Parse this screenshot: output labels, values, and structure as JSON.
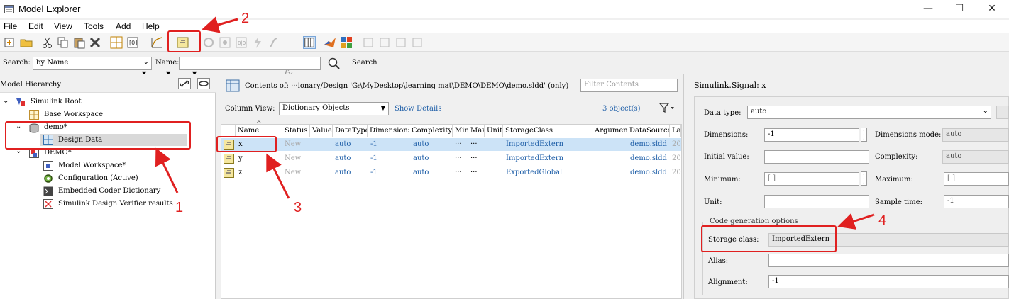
{
  "window": {
    "title": "Model Explorer",
    "minimize": "—",
    "maximize": "☐",
    "close": "✕"
  },
  "menu": {
    "file": "File",
    "edit": "Edit",
    "view": "View",
    "tools": "Tools",
    "add": "Add",
    "help": "Help"
  },
  "search": {
    "label": "Search:",
    "by": "by Name",
    "name_label": "Name:",
    "name_value": "",
    "button": "Search"
  },
  "hierarchy": {
    "title": "Model Hierarchy",
    "items": [
      {
        "label": "Simulink Root"
      },
      {
        "label": "Base Workspace"
      },
      {
        "label": "demo*"
      },
      {
        "label": "Design Data"
      },
      {
        "label": "DEMO*"
      },
      {
        "label": "Model Workspace*"
      },
      {
        "label": "Configuration (Active)"
      },
      {
        "label": "Embedded Coder Dictionary"
      },
      {
        "label": "Simulink Design Verifier results"
      }
    ]
  },
  "contents": {
    "header": "Contents of: ···ionary/Design 'G:\\MyDesktop\\learning mat\\DEMO\\DEMO\\demo.sldd' (only)",
    "filter_placeholder": "Filter Contents",
    "column_view_label": "Column View:",
    "column_view_value": "Dictionary Objects",
    "show_details": "Show Details",
    "count": "3 object(s)",
    "columns": [
      "Name",
      "Status",
      "Value",
      "DataType",
      "Dimensions",
      "Complexity",
      "Min",
      "Max",
      "Unit",
      "StorageClass",
      "Argument",
      "DataSource",
      "La"
    ],
    "rows": [
      {
        "name": "x",
        "status": "New",
        "datatype": "auto",
        "dims": "-1",
        "complexity": "auto",
        "min": "···",
        "max": "···",
        "storage": "ImportedExtern",
        "source": "demo.sldd",
        "la": "20"
      },
      {
        "name": "y",
        "status": "New",
        "datatype": "auto",
        "dims": "-1",
        "complexity": "auto",
        "min": "···",
        "max": "···",
        "storage": "ImportedExtern",
        "source": "demo.sldd",
        "la": "20"
      },
      {
        "name": "z",
        "status": "New",
        "datatype": "auto",
        "dims": "-1",
        "complexity": "auto",
        "min": "···",
        "max": "···",
        "storage": "ExportedGlobal",
        "source": "demo.sldd",
        "la": "20"
      }
    ]
  },
  "props": {
    "title": "Simulink.Signal: x",
    "data_type_label": "Data type:",
    "data_type": "auto",
    "dimensions_label": "Dimensions:",
    "dimensions": "-1",
    "dimensions_mode_label": "Dimensions mode:",
    "dimensions_mode": "auto",
    "initial_value_label": "Initial value:",
    "initial_value": "",
    "complexity_label": "Complexity:",
    "complexity": "auto",
    "minimum_label": "Minimum:",
    "minimum": "[ ]",
    "maximum_label": "Maximum:",
    "maximum": "[ ]",
    "unit_label": "Unit:",
    "unit": "",
    "sample_time_label": "Sample time:",
    "sample_time": "-1",
    "codegen_label": "Code generation options",
    "storage_class_label": "Storage class:",
    "storage_class": "ImportedExtern",
    "alias_label": "Alias:",
    "alias": "",
    "alignment_label": "Alignment:",
    "alignment": "-1"
  },
  "annotations": {
    "n1": "1",
    "n2": "2",
    "n3": "3",
    "n4": "4",
    "color": "#e02020"
  }
}
